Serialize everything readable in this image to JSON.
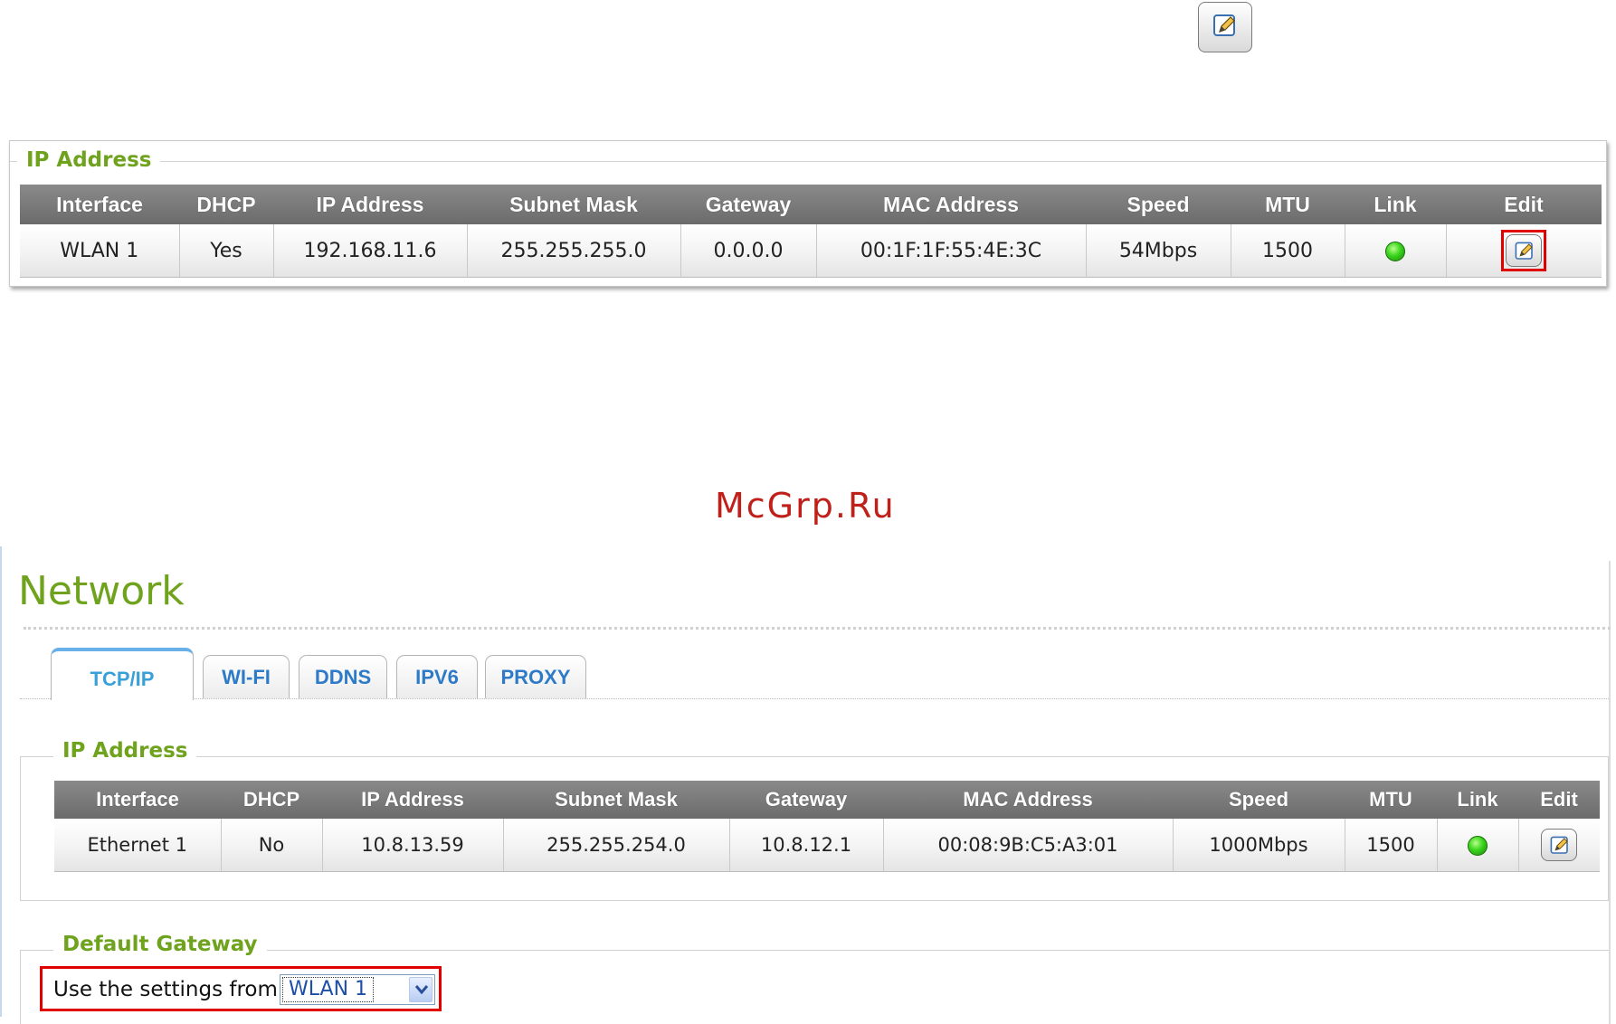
{
  "top_panel": {
    "legend": "IP Address",
    "columns": [
      "Interface",
      "DHCP",
      "IP Address",
      "Subnet Mask",
      "Gateway",
      "MAC Address",
      "Speed",
      "MTU",
      "Link",
      "Edit"
    ],
    "rows": [
      {
        "interface": "WLAN 1",
        "dhcp": "Yes",
        "ip": "192.168.11.6",
        "subnet": "255.255.255.0",
        "gateway": "0.0.0.0",
        "mac": "00:1F:1F:55:4E:3C",
        "speed": "54Mbps",
        "mtu": "1500",
        "link": "up",
        "edit_icon": "edit-pencil-icon"
      }
    ],
    "highlight_color": "#e00000"
  },
  "watermark": "McGrp.Ru",
  "network": {
    "title": "Network",
    "tabs": [
      {
        "label": "TCP/IP",
        "active": true
      },
      {
        "label": "WI-FI",
        "active": false
      },
      {
        "label": "DDNS",
        "active": false
      },
      {
        "label": "IPV6",
        "active": false
      },
      {
        "label": "PROXY",
        "active": false
      }
    ],
    "ip_panel": {
      "legend": "IP Address",
      "columns": [
        "Interface",
        "DHCP",
        "IP Address",
        "Subnet Mask",
        "Gateway",
        "MAC Address",
        "Speed",
        "MTU",
        "Link",
        "Edit"
      ],
      "rows": [
        {
          "interface": "Ethernet 1",
          "dhcp": "No",
          "ip": "10.8.13.59",
          "subnet": "255.255.254.0",
          "gateway": "10.8.12.1",
          "mac": "00:08:9B:C5:A3:01",
          "speed": "1000Mbps",
          "mtu": "1500",
          "link": "up",
          "edit_icon": "edit-pencil-icon"
        }
      ]
    },
    "default_gateway": {
      "legend": "Default Gateway",
      "label": "Use the settings from:",
      "selected": "WLAN 1"
    }
  },
  "colors": {
    "green_title": "#6fa31e",
    "tab_blue": "#2d7bc8",
    "link_led": "#39d41c",
    "table_header": "#7a7a7a"
  }
}
